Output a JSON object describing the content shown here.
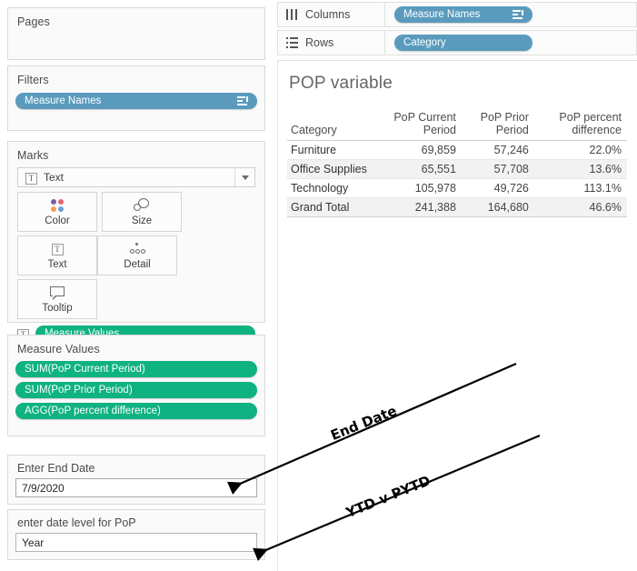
{
  "left_panel": {
    "pages": {
      "title": "Pages"
    },
    "filters": {
      "title": "Filters",
      "pill": {
        "label": "Measure Names",
        "icon": "sort-icon"
      }
    },
    "marks": {
      "title": "Marks",
      "mark_type": {
        "value": "Text",
        "icon": "text-mark-icon",
        "caret": "chevron-down-icon"
      },
      "buttons": [
        {
          "label": "Color",
          "icon": "color-palette-icon"
        },
        {
          "label": "Size",
          "icon": "size-circles-icon"
        },
        {
          "label": "Text",
          "icon": "text-label-icon"
        },
        {
          "label": "Detail",
          "icon": "detail-dots-icon"
        },
        {
          "label": "Tooltip",
          "icon": "tooltip-bubble-icon"
        }
      ],
      "pill": {
        "label": "Measure Values",
        "icon": "text-label-icon"
      }
    },
    "measure_values": {
      "title": "Measure Values",
      "pills": [
        {
          "label": "SUM(PoP Current Period)"
        },
        {
          "label": "SUM(PoP Prior Period)"
        },
        {
          "label": "AGG(PoP percent difference)"
        }
      ]
    },
    "parameters": [
      {
        "label": "Enter End Date",
        "value": "7/9/2020",
        "name": "end-date"
      },
      {
        "label": "enter date level for PoP",
        "value": "Year",
        "name": "date-level"
      }
    ]
  },
  "shelves": [
    {
      "name": "columns",
      "label": "Columns",
      "icon": "columns-icon",
      "pill": {
        "label": "Measure Names",
        "icon": "sort-icon"
      }
    },
    {
      "name": "rows",
      "label": "Rows",
      "icon": "rows-icon",
      "pill": {
        "label": "Category",
        "icon": "none"
      }
    }
  ],
  "viz": {
    "title": "POP variable"
  },
  "chart_data": {
    "type": "table",
    "title": "POP variable",
    "columns": [
      "Category",
      "PoP Current Period",
      "PoP Prior Period",
      "PoP percent difference"
    ],
    "rows": [
      {
        "category": "Furniture",
        "current": "69,859",
        "prior": "57,246",
        "pct": "22.0%"
      },
      {
        "category": "Office Supplies",
        "current": "65,551",
        "prior": "57,708",
        "pct": "13.6%"
      },
      {
        "category": "Technology",
        "current": "105,978",
        "prior": "49,726",
        "pct": "113.1%"
      },
      {
        "category": "Grand Total",
        "current": "241,388",
        "prior": "164,680",
        "pct": "46.6%"
      }
    ],
    "values": {
      "PoP Current Period": [
        69859,
        65551,
        105978,
        241388
      ],
      "PoP Prior Period": [
        57246,
        57708,
        49726,
        164680
      ],
      "PoP percent difference": [
        22.0,
        13.6,
        113.1,
        46.6
      ]
    },
    "categories": [
      "Furniture",
      "Office Supplies",
      "Technology",
      "Grand Total"
    ],
    "grid": true,
    "legend": "none"
  },
  "annotations": [
    {
      "text": "End Date",
      "name": "annotation-end-date"
    },
    {
      "text": "YTD v PYTD",
      "name": "annotation-ytd-v-pytd"
    }
  ],
  "colors": {
    "pill_blue": "#5a9bbd",
    "pill_green": "#0fb281",
    "card_bg": "#fafafa",
    "alt_row": "#f2f2f2",
    "title_text": "#666666"
  }
}
